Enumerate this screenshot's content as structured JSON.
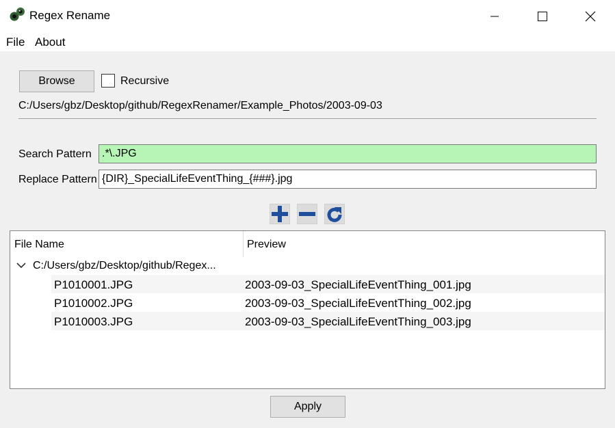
{
  "window": {
    "title": "Regex Rename",
    "icon": "regex-rename-app-icon",
    "controls": [
      "minimize-icon",
      "maximize-icon",
      "close-icon"
    ]
  },
  "menu": {
    "file": "File",
    "about": "About"
  },
  "browse": {
    "button_label": "Browse",
    "recursive_label": "Recursive",
    "recursive_checked": false,
    "current_path": "C:/Users/gbz/Desktop/github/RegexRenamer/Example_Photos/2003-09-03"
  },
  "patterns": {
    "search_label": "Search Pattern",
    "search_value": ".*\\.JPG",
    "search_valid_color": "#b7f5b7",
    "replace_label": "Replace Pattern",
    "replace_value": "{DIR}_SpecialLifeEventThing_{###}.jpg"
  },
  "toolbar": {
    "add_icon": "plus-icon",
    "remove_icon": "minus-icon",
    "refresh_icon": "refresh-icon",
    "icon_color": "#1f4e9c"
  },
  "tree": {
    "col_filename": "File Name",
    "col_preview": "Preview",
    "directory": "C:/Users/gbz/Desktop/github/Regex...",
    "rows": [
      {
        "name": "P1010001.JPG",
        "preview": "2003-09-03_SpecialLifeEventThing_001.jpg"
      },
      {
        "name": "P1010002.JPG",
        "preview": "2003-09-03_SpecialLifeEventThing_002.jpg"
      },
      {
        "name": "P1010003.JPG",
        "preview": "2003-09-03_SpecialLifeEventThing_003.jpg"
      }
    ]
  },
  "actions": {
    "apply_label": "Apply"
  }
}
